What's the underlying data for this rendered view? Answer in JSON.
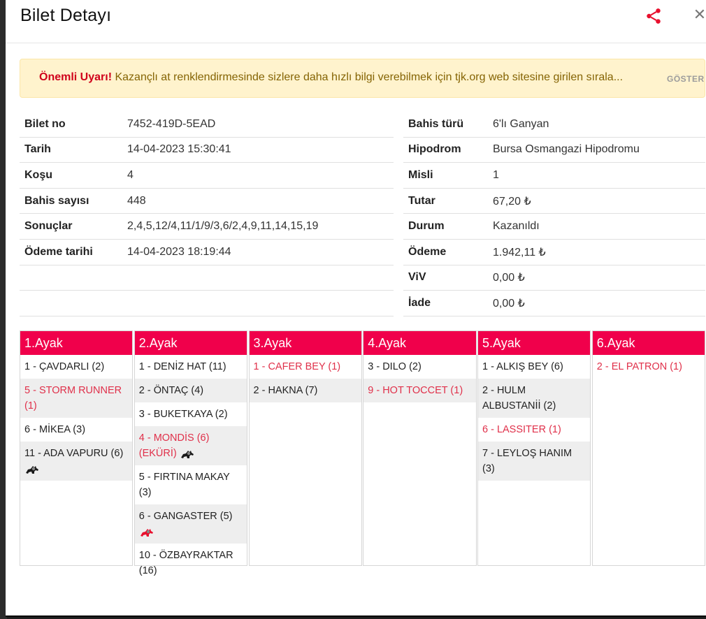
{
  "title": "Bilet Detayı",
  "warning": {
    "label": "Önemli Uyarı!",
    "text": "Kazançlı at renklendirmesinde sizlere daha hızlı bilgi verebilmek için tjk.org web sitesine girilen sırala...",
    "button": "GÖSTER"
  },
  "info_left": [
    {
      "key": "Bilet no",
      "value": "7452-419D-5EAD"
    },
    {
      "key": "Tarih",
      "value": "14-04-2023 15:30:41"
    },
    {
      "key": "Koşu",
      "value": "4"
    },
    {
      "key": "Bahis sayısı",
      "value": "448"
    },
    {
      "key": "Sonuçlar",
      "value": "2,4,5,12/4,11/1/9/3,6/2,4,9,11,14,15,19"
    },
    {
      "key": "Ödeme tarihi",
      "value": "14-04-2023 18:19:44"
    }
  ],
  "info_right": [
    {
      "key": "Bahis türü",
      "value": "6'lı Ganyan"
    },
    {
      "key": "Hipodrom",
      "value": "Bursa Osmangazi Hipodromu"
    },
    {
      "key": "Misli",
      "value": "1"
    },
    {
      "key": "Tutar",
      "value": "67,20 ₺"
    },
    {
      "key": "Durum",
      "value": "Kazanıldı"
    },
    {
      "key": "Ödeme",
      "value": "1.942,11 ₺"
    },
    {
      "key": "ViV",
      "value": "0,00 ₺"
    },
    {
      "key": "İade",
      "value": "0,00 ₺"
    }
  ],
  "legs": [
    {
      "title": "1.Ayak",
      "runners": [
        {
          "text": "1 - ÇAVDARLI (2)",
          "win": false
        },
        {
          "text": "5 - STORM RUNNER (1)",
          "win": true
        },
        {
          "text": "6 - MİKEA (3)",
          "win": false
        },
        {
          "text": "11 - ADA VAPURU (6)",
          "win": false,
          "icon": "dark-horse-icon"
        }
      ]
    },
    {
      "title": "2.Ayak",
      "runners": [
        {
          "text": "1 - DENİZ HAT (11)",
          "win": false
        },
        {
          "text": "2 - ÖNTAÇ (4)",
          "win": false
        },
        {
          "text": "3 - BUKETKAYA (2)",
          "win": false
        },
        {
          "text": "4 - MONDİS (6) (EKÜRİ)",
          "win": true,
          "icon": "dark-horse-icon"
        },
        {
          "text": "5 - FIRTINA MAKAY (3)",
          "win": false
        },
        {
          "text": "6 - GANGASTER (5)",
          "win": false,
          "icon": "red-horse-icon"
        },
        {
          "text": "10 - ÖZBAYRAKTAR (16)",
          "win": false
        }
      ]
    },
    {
      "title": "3.Ayak",
      "runners": [
        {
          "text": "1 - CAFER BEY (1)",
          "win": true
        },
        {
          "text": "2 - HAKNA (7)",
          "win": false
        }
      ]
    },
    {
      "title": "4.Ayak",
      "runners": [
        {
          "text": "3 - DILO (2)",
          "win": false
        },
        {
          "text": "9 - HOT TOCCET (1)",
          "win": true
        }
      ]
    },
    {
      "title": "5.Ayak",
      "runners": [
        {
          "text": "1 - ALKIŞ BEY (6)",
          "win": false
        },
        {
          "text": "2 - HULM ALBUSTANİİ (2)",
          "win": false
        },
        {
          "text": "6 - LASSITER (1)",
          "win": true
        },
        {
          "text": "7 - LEYLOŞ HANIM (3)",
          "win": false
        }
      ]
    },
    {
      "title": "6.Ayak",
      "runners": [
        {
          "text": "2 - EL PATRON (1)",
          "win": true
        }
      ]
    }
  ],
  "colors": {
    "accent": "#f0004b",
    "win": "#e0304a",
    "warning_bg": "#fff3cd"
  }
}
